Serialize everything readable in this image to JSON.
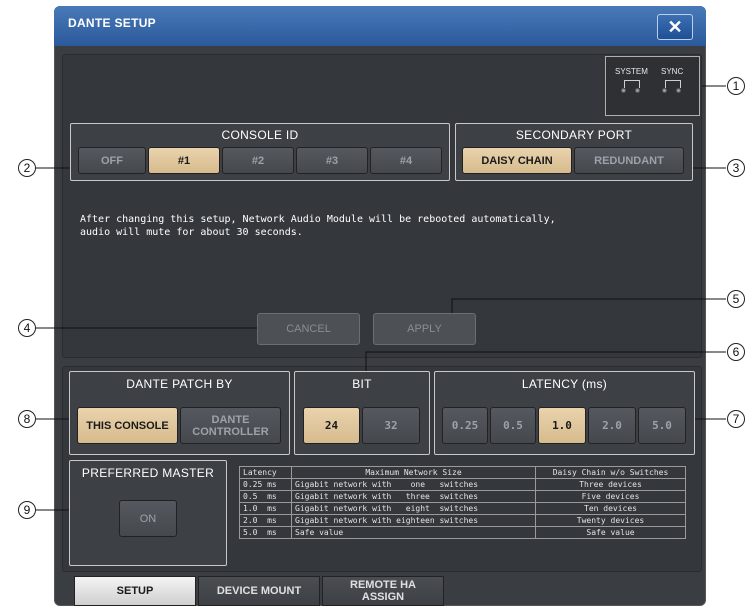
{
  "window": {
    "title": "DANTE SETUP",
    "close_glyph": "✕"
  },
  "system_sync": {
    "system_label": "SYSTEM",
    "sync_label": "SYNC"
  },
  "console_id": {
    "title": "CONSOLE ID",
    "options": [
      "OFF",
      "#1",
      "#2",
      "#3",
      "#4"
    ],
    "selected": "#1"
  },
  "secondary_port": {
    "title": "SECONDARY PORT",
    "options": [
      "DAISY CHAIN",
      "REDUNDANT"
    ],
    "selected": "DAISY CHAIN"
  },
  "info_text": "After changing this setup, Network Audio Module will be rebooted automatically,\naudio will mute for about 30 seconds.",
  "actions": {
    "cancel": "CANCEL",
    "apply": "APPLY"
  },
  "patch_by": {
    "title": "DANTE PATCH BY",
    "options": [
      "THIS CONSOLE",
      "DANTE CONTROLLER"
    ],
    "selected": "THIS CONSOLE"
  },
  "bit": {
    "title": "BIT",
    "options": [
      "24",
      "32"
    ],
    "selected": "24"
  },
  "latency": {
    "title": "LATENCY (ms)",
    "options": [
      "0.25",
      "0.5",
      "1.0",
      "2.0",
      "5.0"
    ],
    "selected": "1.0"
  },
  "preferred_master": {
    "title": "PREFERRED MASTER",
    "button": "ON"
  },
  "latency_table": {
    "headers": [
      "Latency",
      "Maximum Network Size",
      "Daisy Chain w/o Switches"
    ],
    "rows": [
      [
        "0.25 ms",
        "Gigabit network with    one   switches",
        "Three devices"
      ],
      [
        "0.5  ms",
        "Gigabit network with   three  switches",
        "Five devices"
      ],
      [
        "1.0  ms",
        "Gigabit network with   eight  switches",
        "Ten devices"
      ],
      [
        "2.0  ms",
        "Gigabit network with eighteen switches",
        "Twenty devices"
      ],
      [
        "5.0  ms",
        "Safe value",
        "Safe value"
      ]
    ]
  },
  "tabs": [
    "SETUP",
    "DEVICE MOUNT",
    "REMOTE HA ASSIGN"
  ],
  "active_tab": "SETUP",
  "callouts": [
    "1",
    "2",
    "3",
    "4",
    "5",
    "6",
    "7",
    "8",
    "9"
  ]
}
